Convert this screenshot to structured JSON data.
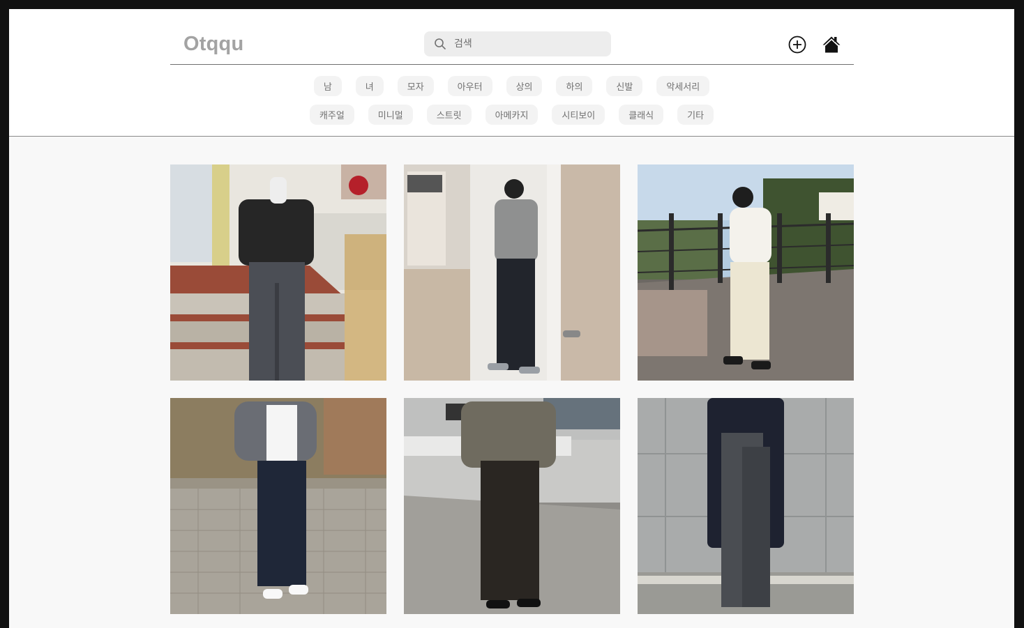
{
  "header": {
    "logo": "Otqqu",
    "search_placeholder": "검색"
  },
  "icons": {
    "search": "search-icon",
    "add": "plus-circle-icon",
    "home": "home-icon"
  },
  "categories": {
    "row1": [
      "남",
      "녀",
      "모자",
      "아우터",
      "상의",
      "하의",
      "신발",
      "악세서리"
    ],
    "row2": [
      "캐주얼",
      "미니멀",
      "스트릿",
      "아메카지",
      "시티보이",
      "클래식",
      "기타"
    ]
  },
  "colors": {
    "frame": "#111111",
    "page_bg": "#f8f8f8",
    "header_bg": "#ffffff",
    "logo": "#a3a3a3",
    "chip_bg": "#f3f3f3",
    "chip_text": "#707070",
    "search_bg": "#ededed"
  }
}
